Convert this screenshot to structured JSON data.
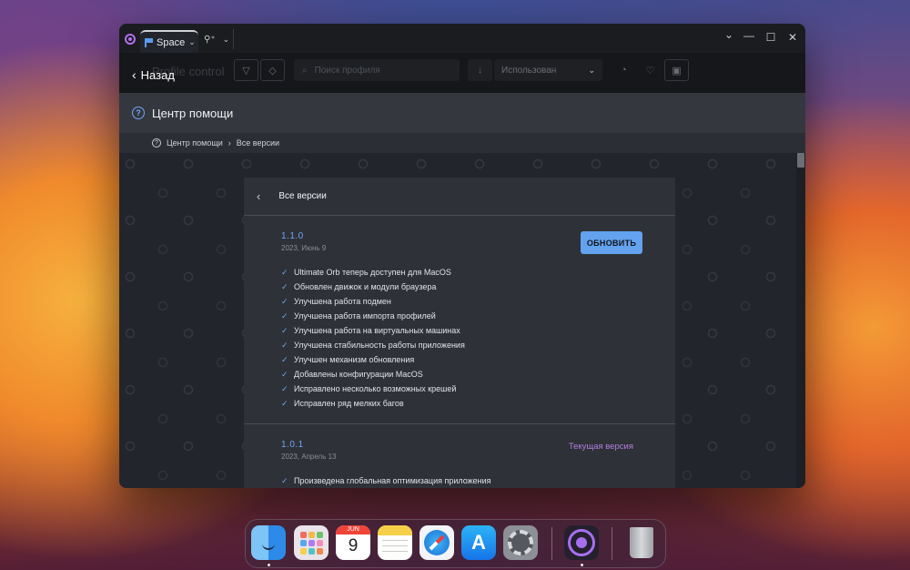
{
  "window": {
    "tab_label": "Space",
    "controls": {
      "chevron": "⌄",
      "minimize": "—",
      "maximize": "☐",
      "close": "✕"
    }
  },
  "toolbar": {
    "back_label": "Назад",
    "ghost_title": "Profile control",
    "search_placeholder": "Поиск профиля",
    "select_value": "Использован",
    "icons": [
      "filter-icon",
      "eraser-icon",
      "sort-icon",
      "chevron-down-icon",
      "fire-icon",
      "heart-icon",
      "calendar-icon"
    ]
  },
  "header": {
    "title": "Центр помощи"
  },
  "breadcrumb": {
    "items": [
      "Центр помощи",
      "Все версии"
    ]
  },
  "card": {
    "title": "Все версии",
    "releases": [
      {
        "version": "1.1.0",
        "date": "2023, Июнь 9",
        "action_label": "ОБНОВИТЬ",
        "changes": [
          "Ultimate Orb теперь доступен для MacOS",
          "Обновлен движок и модули браузера",
          "Улучшена работа подмен",
          "Улучшена работа импорта профилей",
          "Улучшена работа на виртуальных машинах",
          "Улучшена стабильность работы приложения",
          "Улучшен механизм обновления",
          "Добавлены конфигурации MacOS",
          "Исправлено несколько возможных крешей",
          "Исправлен ряд мелких багов"
        ]
      },
      {
        "version": "1.0.1",
        "date": "2023, Апрель 13",
        "status_label": "Текущая версия",
        "changes": [
          "Произведена глобальная оптимизация приложения"
        ]
      }
    ]
  },
  "dock": {
    "calendar_month": "JUN",
    "calendar_day": "9",
    "apps": [
      "finder-icon",
      "launchpad-icon",
      "calendar-icon",
      "notes-icon",
      "safari-icon",
      "app-store-icon",
      "system-settings-icon",
      "ultimate-orb-icon",
      "trash-icon"
    ]
  },
  "colors": {
    "accent": "#63a2ee",
    "current_version": "#b57de0",
    "orb": "#a76ff0"
  }
}
